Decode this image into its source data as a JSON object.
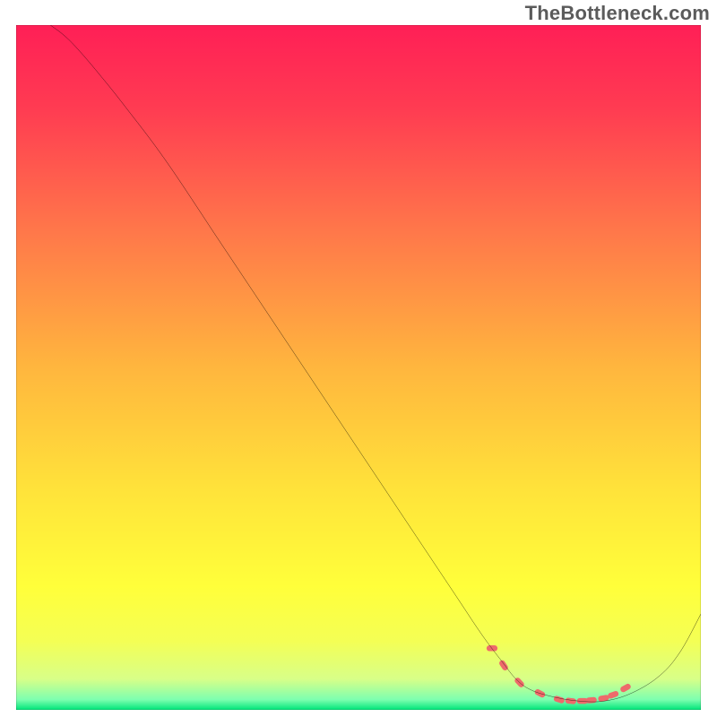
{
  "watermark": "TheBottleneck.com",
  "chart_data": {
    "type": "line",
    "title": "",
    "xlabel": "",
    "ylabel": "",
    "xlim": [
      0,
      100
    ],
    "ylim": [
      0,
      100
    ],
    "background_gradient_stops": [
      {
        "offset": 0.0,
        "color": "#ff1f56"
      },
      {
        "offset": 0.12,
        "color": "#ff3b52"
      },
      {
        "offset": 0.3,
        "color": "#ff774a"
      },
      {
        "offset": 0.5,
        "color": "#ffb63e"
      },
      {
        "offset": 0.68,
        "color": "#ffe33a"
      },
      {
        "offset": 0.82,
        "color": "#ffff3a"
      },
      {
        "offset": 0.9,
        "color": "#f4ff55"
      },
      {
        "offset": 0.955,
        "color": "#d8ff88"
      },
      {
        "offset": 0.985,
        "color": "#7dffb0"
      },
      {
        "offset": 1.0,
        "color": "#00e57a"
      }
    ],
    "series": [
      {
        "name": "bottleneck-curve",
        "color": "#000000",
        "x": [
          5,
          7,
          9,
          12,
          16,
          22,
          30,
          40,
          50,
          58,
          64,
          68,
          71,
          73,
          75,
          78,
          82,
          86,
          90,
          94,
          97,
          100
        ],
        "y": [
          100,
          98.5,
          96.5,
          93,
          88,
          80,
          68,
          53,
          38,
          26,
          17,
          11,
          7,
          4.5,
          3,
          2,
          1.3,
          1.3,
          2.5,
          5,
          8.5,
          14
        ]
      }
    ],
    "markers": {
      "name": "optimal-range-dots",
      "color": "#ee6b6b",
      "x": [
        69.5,
        71.2,
        73.5,
        76.5,
        79.3,
        81.0,
        82.7,
        84.0,
        85.8,
        87.2,
        89.0
      ],
      "y": [
        9.0,
        6.5,
        4.0,
        2.4,
        1.5,
        1.3,
        1.3,
        1.4,
        1.7,
        2.2,
        3.2
      ]
    }
  }
}
